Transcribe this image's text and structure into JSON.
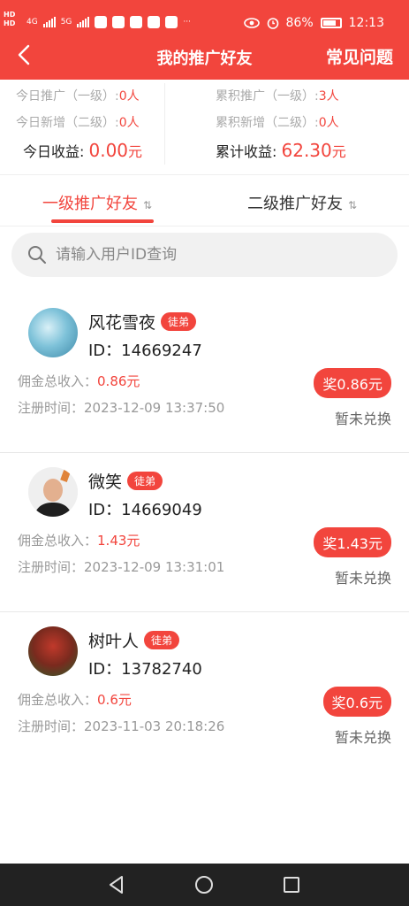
{
  "status_bar": {
    "network_left": "HD",
    "signal_1": "4G",
    "signal_2": "5G",
    "battery": "86%",
    "time": "12:13"
  },
  "header": {
    "title": "我的推广好友",
    "faq_label": "常见问题"
  },
  "stats": {
    "today_level1_label": "今日推广（一级）:",
    "today_level1_value": "0人",
    "today_level2_label": "今日新增（二级）:",
    "today_level2_value": "0人",
    "today_earn_label": "今日收益:",
    "today_earn_value": "0.00",
    "today_earn_unit": "元",
    "total_level1_label": "累积推广（一级）:",
    "total_level1_value": "3人",
    "total_level2_label": "累积新增（二级）:",
    "total_level2_value": "0人",
    "total_earn_label": "累计收益:",
    "total_earn_value": "62.30",
    "total_earn_unit": "元"
  },
  "tabs": [
    {
      "label": "一级推广好友",
      "sort": "⇅",
      "active": true
    },
    {
      "label": "二级推广好友",
      "sort": "⇅",
      "active": false
    }
  ],
  "search": {
    "placeholder": "请输入用户ID查询"
  },
  "friends": [
    {
      "name": "风花雪夜",
      "badge": "徒弟",
      "id": "ID：14669247",
      "commission_label": "佣金总收入：",
      "commission_value": "0.86元",
      "register_label": "注册时间：",
      "register_time": "2023-12-09 13:37:50",
      "reward": "奖0.86元",
      "exchange_status": "暂未兑换"
    },
    {
      "name": "微笑",
      "badge": "徒弟",
      "id": "ID：14669049",
      "commission_label": "佣金总收入：",
      "commission_value": "1.43元",
      "register_label": "注册时间：",
      "register_time": "2023-12-09 13:31:01",
      "reward": "奖1.43元",
      "exchange_status": "暂未兑换"
    },
    {
      "name": "树叶人",
      "badge": "徒弟",
      "id": "ID：13782740",
      "commission_label": "佣金总收入：",
      "commission_value": "0.6元",
      "register_label": "注册时间：",
      "register_time": "2023-11-03 20:18:26",
      "reward": "奖0.6元",
      "exchange_status": "暂未兑换"
    }
  ],
  "icons": {
    "back": "chevron-left-icon",
    "search": "search-icon",
    "nav_back": "triangle-back-icon",
    "nav_home": "circle-home-icon",
    "nav_recent": "square-recent-icon"
  },
  "colors": {
    "accent": "#f2453d",
    "navbar": "#222222"
  }
}
